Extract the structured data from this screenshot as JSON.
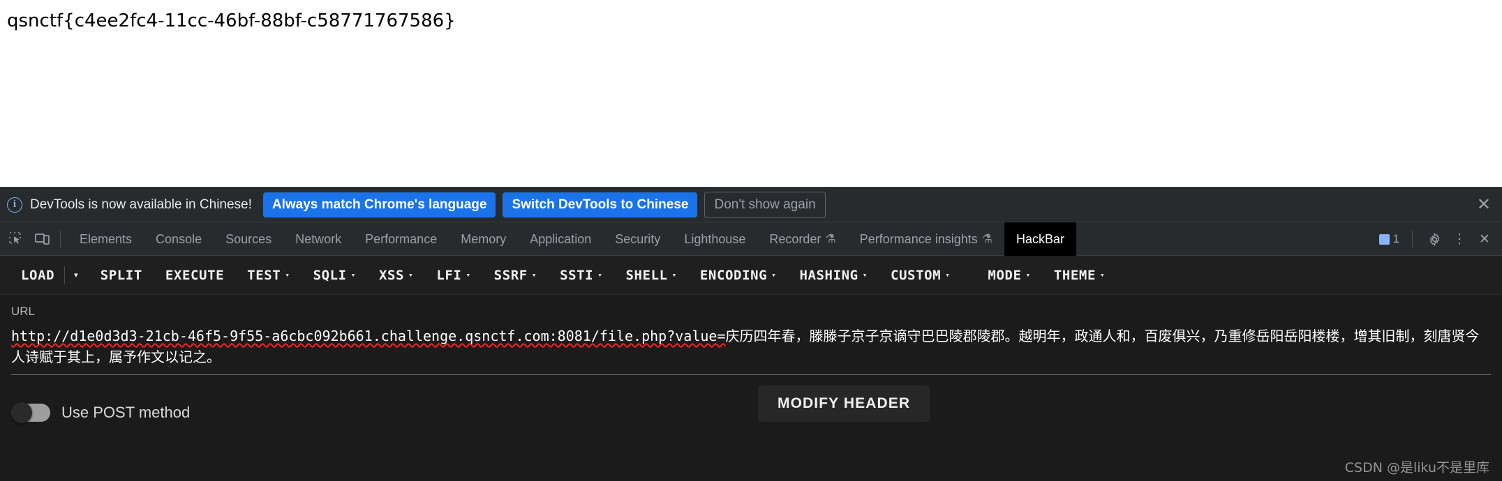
{
  "page": {
    "flag_text": "qsnctf{c4ee2fc4-11cc-46bf-88bf-c58771767586}"
  },
  "notification": {
    "info_icon": "info-icon",
    "message": "DevTools is now available in Chinese!",
    "primary_button": "Always match Chrome's language",
    "secondary_button": "Switch DevTools to Chinese",
    "dismiss_button": "Don't show again",
    "close_icon": "✕",
    "primary_color": "#1a73e8",
    "accent_color": "#8ab4f8"
  },
  "devtools": {
    "left_icons": [
      "inspect-element-icon",
      "device-toolbar-icon"
    ],
    "tabs": [
      {
        "label": "Elements",
        "active": false,
        "flask": false
      },
      {
        "label": "Console",
        "active": false,
        "flask": false
      },
      {
        "label": "Sources",
        "active": false,
        "flask": false
      },
      {
        "label": "Network",
        "active": false,
        "flask": false
      },
      {
        "label": "Performance",
        "active": false,
        "flask": false
      },
      {
        "label": "Memory",
        "active": false,
        "flask": false
      },
      {
        "label": "Application",
        "active": false,
        "flask": false
      },
      {
        "label": "Security",
        "active": false,
        "flask": false
      },
      {
        "label": "Lighthouse",
        "active": false,
        "flask": false
      },
      {
        "label": "Recorder",
        "active": false,
        "flask": true
      },
      {
        "label": "Performance insights",
        "active": false,
        "flask": true
      },
      {
        "label": "HackBar",
        "active": true,
        "flask": false
      }
    ],
    "flask_glyph": "⚗",
    "message_count": "1",
    "settings_icon": "gear-icon",
    "more_icon": "⋮",
    "close_icon": "✕"
  },
  "hackbar": {
    "buttons": [
      {
        "label": "LOAD",
        "caret": false
      },
      {
        "label": "SPLIT",
        "caret": false
      },
      {
        "label": "EXECUTE",
        "caret": false
      },
      {
        "label": "TEST",
        "caret": true
      },
      {
        "label": "SQLI",
        "caret": true
      },
      {
        "label": "XSS",
        "caret": true
      },
      {
        "label": "LFI",
        "caret": true
      },
      {
        "label": "SSRF",
        "caret": true
      },
      {
        "label": "SSTI",
        "caret": true
      },
      {
        "label": "SHELL",
        "caret": true
      },
      {
        "label": "ENCODING",
        "caret": true
      },
      {
        "label": "HASHING",
        "caret": true
      },
      {
        "label": "CUSTOM",
        "caret": true
      }
    ],
    "right_buttons": [
      {
        "label": "MODE",
        "caret": true
      },
      {
        "label": "THEME",
        "caret": true
      }
    ],
    "caret_glyph": "▾",
    "load_caret_glyph": "▾",
    "url_label": "URL",
    "url_value_ascii": "http://d1e0d3d3-21cb-46f5-9f55-a6cbc092b661.challenge.qsnctf.com:8081/file.php?value=",
    "url_value_cjk": "庆历四年春，滕滕子京子京谪守巴巴陵郡陵郡。越明年，政通人和，百废俱兴，乃重修岳阳岳阳楼楼，增其旧制，刻唐贤今人诗赋于其上，属予作文以记之。",
    "post_toggle_label": "Use POST method",
    "post_toggle_state": "off",
    "modify_header_button": "MODIFY HEADER"
  },
  "watermark": {
    "text": "CSDN @是liku不是里库"
  }
}
